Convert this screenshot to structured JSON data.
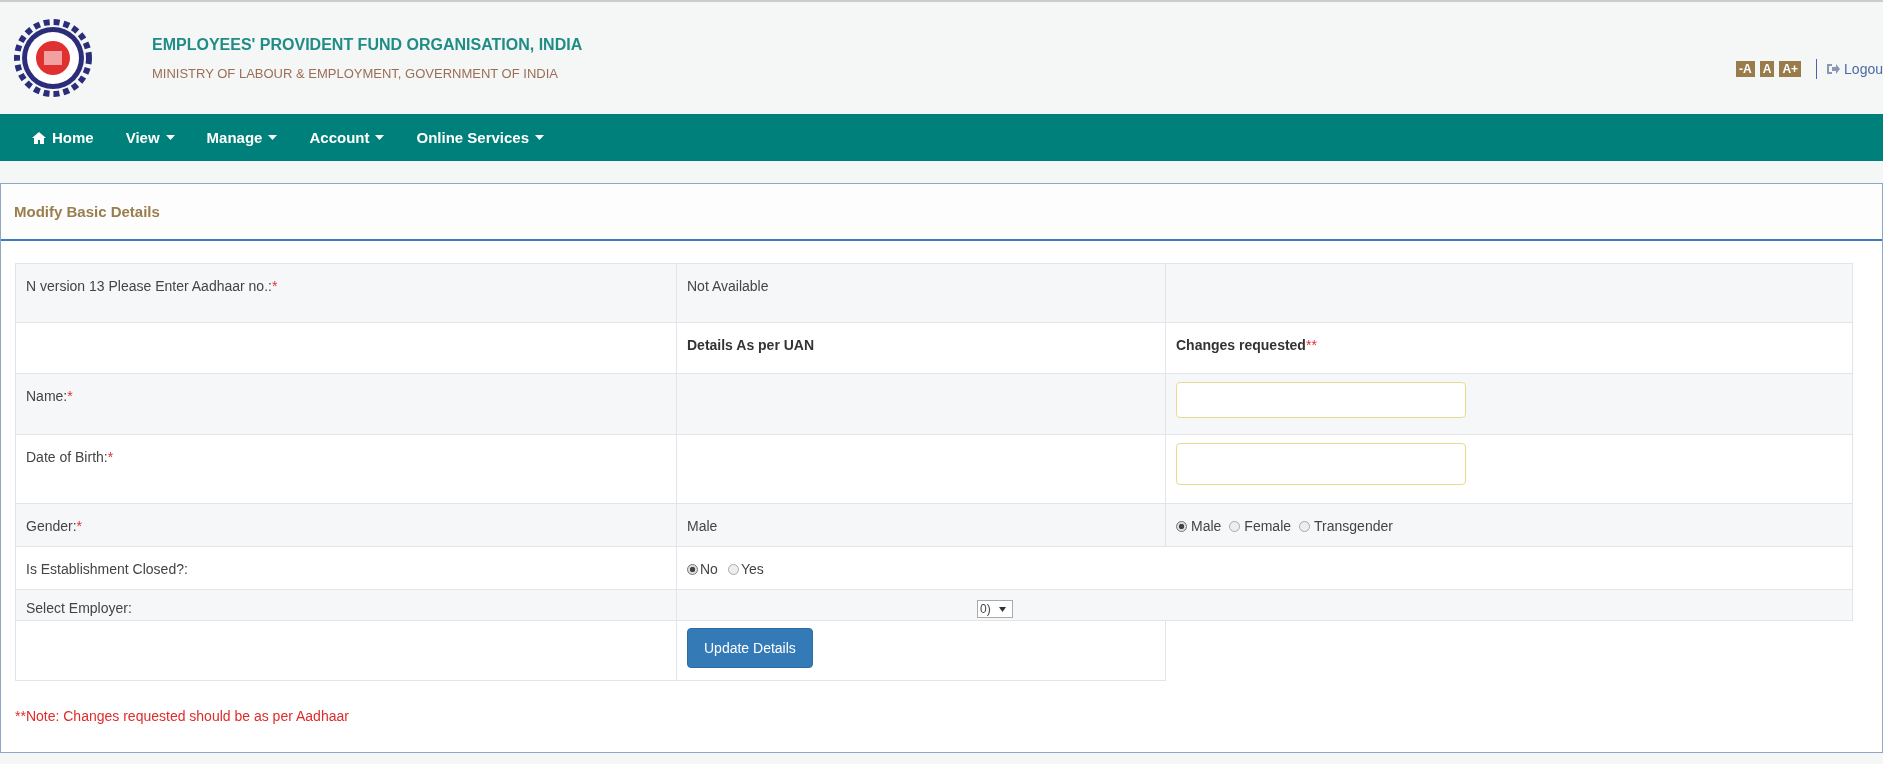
{
  "header": {
    "title": "EMPLOYEES' PROVIDENT FUND ORGANISATION, INDIA",
    "subtitle": "MINISTRY OF LABOUR & EMPLOYMENT, GOVERNMENT OF INDIA",
    "font_buttons": [
      "-A",
      "A",
      "A+"
    ],
    "logout": "Logou"
  },
  "nav": [
    {
      "label": "Home",
      "kind": "home"
    },
    {
      "label": "View",
      "kind": "dropdown"
    },
    {
      "label": "Manage",
      "kind": "dropdown"
    },
    {
      "label": "Account",
      "kind": "dropdown"
    },
    {
      "label": "Online Services",
      "kind": "dropdown"
    }
  ],
  "panel": {
    "title": "Modify Basic Details"
  },
  "rows": [
    {
      "kind": "text",
      "label": "N version 13 Please Enter Aadhaar no.:",
      "mark": "*",
      "value": "Not Available"
    },
    {
      "kind": "header",
      "col2": "Details As per UAN",
      "col3": "Changes requested",
      "col3_mark": "**"
    },
    {
      "kind": "input",
      "label": "Name:",
      "mark": "*"
    },
    {
      "kind": "input",
      "label": "Date of Birth:",
      "mark": "*"
    },
    {
      "kind": "radio",
      "label": "Gender:",
      "mark": "*",
      "value": "Male",
      "options": [
        {
          "label": "Male",
          "selected": true
        },
        {
          "label": "Female",
          "selected": false
        },
        {
          "label": "Transgender",
          "selected": false
        }
      ]
    },
    {
      "kind": "radio-wide",
      "label": "Is Establishment Closed?:",
      "options": [
        {
          "label": "No",
          "selected": true
        },
        {
          "label": "Yes",
          "selected": false
        }
      ]
    },
    {
      "kind": "select",
      "label": "Select Employer:",
      "value": "0)"
    },
    {
      "kind": "button",
      "button": "Update Details"
    }
  ],
  "note": "**Note: Changes requested should be as per Aadhaar"
}
